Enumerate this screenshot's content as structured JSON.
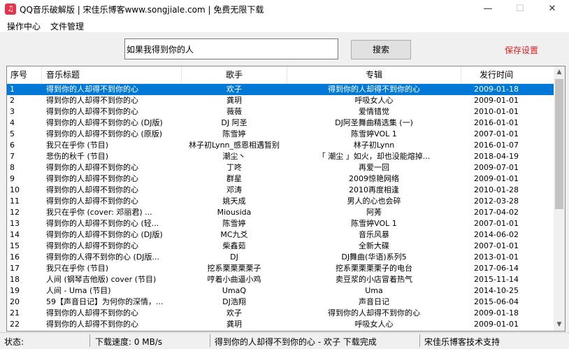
{
  "window": {
    "title": "QQ音乐破解版 | 宋佳乐博客www.songjiale.com | 免费无限下载",
    "minimize": "—",
    "maximize": "☐",
    "close": "✕"
  },
  "menu": [
    "操作中心",
    "文件管理"
  ],
  "search": {
    "value": "如果我得到你的人",
    "button": "搜索"
  },
  "save_settings": "保存设置",
  "colors": {
    "accent": "#0078d7",
    "link_red": "#e01e1e"
  },
  "table": {
    "headers": [
      "序号",
      "音乐标题",
      "歌手",
      "专辑",
      "发行时间"
    ],
    "rows": [
      [
        "1",
        "得到你的人却得不到你的心",
        "欢子",
        "得到你的人却得不到你的心",
        "2009-01-18"
      ],
      [
        "2",
        "得到你的人却得不到你的心",
        "龚玥",
        "呼吸女人心",
        "2009-01-01"
      ],
      [
        "3",
        "得到你的人却得不到你的心",
        "薇薇",
        "爱情错觉",
        "2010-01-01"
      ],
      [
        "4",
        "得到你的人却得不到你的心 (DJ版)",
        "DJ 阿圣",
        "DJ阿圣舞曲精选集 (一)",
        "2016-01-01"
      ],
      [
        "5",
        "得到你的人却得不到你的心 (原版)",
        "陈雪婷",
        "陈雪婷VOL 1",
        "2007-01-01"
      ],
      [
        "6",
        "我只在乎你 (节目)",
        "林子初Lynn_感恩相遇暂别",
        "林子初Lynn",
        "2016-01-07"
      ],
      [
        "7",
        "悲伤的秋千 (节目)",
        "潮尘丶",
        "「 潮尘 」如火，却也没能熔掉...",
        "2018-04-19"
      ],
      [
        "8",
        "得到你的人却得不到你的心",
        "丁咚",
        "再爱一回",
        "2009-07-01"
      ],
      [
        "9",
        "得到你的人却得不到你的心",
        "群星",
        "2009惊艳网络",
        "2009-01-01"
      ],
      [
        "10",
        "得到你的人却得不到你的心",
        "邓涛",
        "2010再度相逢",
        "2010-01-28"
      ],
      [
        "11",
        "得到你的人却得不到你的心",
        "姚天成",
        "男人的心也会碎",
        "2012-03-28"
      ],
      [
        "12",
        "我只在乎你 (cover: 邓丽君) ...",
        "Miousida",
        "阿莠",
        "2017-04-02"
      ],
      [
        "13",
        "得到你的人却得不到你的心 (轻...",
        "陈雪婷",
        "陈雪婷VOL 1",
        "2007-01-01"
      ],
      [
        "14",
        "得到你的人却得不到你的心 (DJ版)",
        "MC九爻",
        "音乐风暴",
        "2014-06-02"
      ],
      [
        "15",
        "得到你的人却得不到你的心",
        "柴鑫茹",
        "全新大碟",
        "2007-01-01"
      ],
      [
        "16",
        "得到你的人得不到你的心 (DJ版...",
        "DJ",
        "DJ舞曲(华语)系列5",
        "2013-01-01"
      ],
      [
        "17",
        "我只在乎你 (节目)",
        "挖系栗栗栗栗子",
        "挖系栗栗栗栗子的电台",
        "2017-06-14"
      ],
      [
        "18",
        "人间 (钢琴吉他版) cover (节目)",
        "哼着小曲逼小鸡",
        "卖豆浆的小店冒着热气",
        "2015-11-14"
      ],
      [
        "19",
        "人间 - Uma (节目)",
        "UmaQ",
        "Uma",
        "2014-10-25"
      ],
      [
        "20",
        "59【声音日记】为何你的深情，...",
        "DJ浩翔",
        "声音日记",
        "2015-06-04"
      ],
      [
        "21",
        "得到你的人却得不到你的心",
        "欢子",
        "得到你的人却得不到你的心",
        "2009-01-18"
      ],
      [
        "22",
        "得到你的人却得不到你的心",
        "龚玥",
        "呼吸女人心",
        "2009-01-01"
      ]
    ]
  },
  "scrollbar": {
    "up": "▲",
    "down": "▼"
  },
  "status": {
    "label": "状态:",
    "speed": "下载速度: 0 MB/s",
    "message": "得到你的人却得不到你的心 - 欢子  下载完成",
    "credit": "宋佳乐博客技术支持"
  }
}
